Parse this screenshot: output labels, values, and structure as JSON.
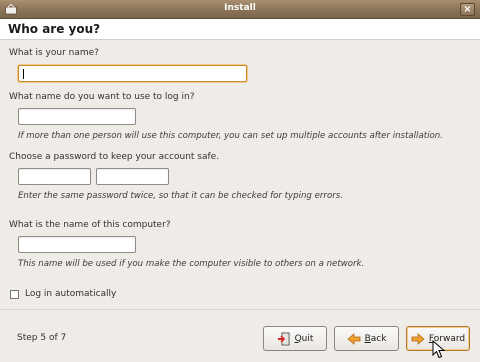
{
  "window": {
    "title": "Install",
    "close_glyph": "×"
  },
  "page": {
    "heading": "Who are you?"
  },
  "fields": {
    "name_label": "What is your name?",
    "name_value": "",
    "login_label": "What name do you want to use to log in?",
    "login_value": "",
    "login_hint": "If more than one person will use this computer, you can set up multiple accounts after installation.",
    "password_label": "Choose a password to keep your account safe.",
    "password_value": "",
    "confirm_value": "",
    "password_hint": "Enter the same password twice, so that it can be checked for typing errors.",
    "computer_label": "What is the name of this computer?",
    "computer_value": "",
    "computer_hint": "This name will be used if you make the computer visible to others on a network."
  },
  "options": {
    "auto_login_label": "Log in automatically",
    "auto_login_checked": false
  },
  "footer": {
    "step_text": "Step 5 of 7",
    "quit_label": "Quit",
    "back_label": "Back",
    "forward_label": "Forward"
  },
  "icons": {
    "window": "install-icon",
    "quit": "quit-icon",
    "back": "arrow-left-icon",
    "forward": "arrow-right-icon"
  },
  "colors": {
    "titlebar": "#8a7357",
    "focus_ring": "#c98a2c",
    "arrow": "#f0a030",
    "quit_red": "#d42a2a"
  }
}
